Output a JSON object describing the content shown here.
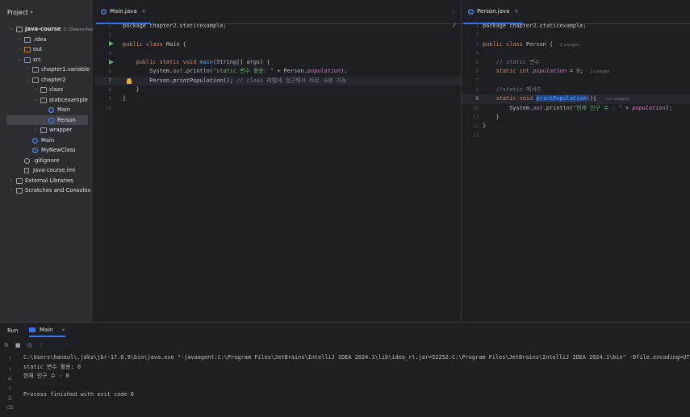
{
  "project": {
    "title": "Project",
    "tree": [
      {
        "label": "Java-course",
        "path": "C:\\Users\\hane",
        "icon": "folder",
        "depth": 0,
        "expanded": true,
        "bold": true
      },
      {
        "label": ".idea",
        "icon": "folder",
        "depth": 1,
        "expanded": false
      },
      {
        "label": "out",
        "icon": "folder-orange",
        "depth": 1,
        "expanded": false
      },
      {
        "label": "src",
        "icon": "folder-blue",
        "depth": 1,
        "expanded": true
      },
      {
        "label": "chapter1.variable",
        "icon": "folder",
        "depth": 2,
        "expanded": false
      },
      {
        "label": "chapter2",
        "icon": "folder",
        "depth": 2,
        "expanded": true
      },
      {
        "label": "clazz",
        "icon": "folder",
        "depth": 3,
        "expanded": false
      },
      {
        "label": "staticexample",
        "icon": "folder",
        "depth": 3,
        "expanded": true
      },
      {
        "label": "Main",
        "icon": "class",
        "depth": 4
      },
      {
        "label": "Person",
        "icon": "class",
        "depth": 4,
        "selected": true
      },
      {
        "label": "wrapper",
        "icon": "folder",
        "depth": 3,
        "expanded": false
      },
      {
        "label": "Main",
        "icon": "class",
        "depth": 2
      },
      {
        "label": "MyNewClass",
        "icon": "class",
        "depth": 2
      },
      {
        "label": ".gitignore",
        "icon": "ignore",
        "depth": 1
      },
      {
        "label": "Java-course.iml",
        "icon": "file",
        "depth": 1
      },
      {
        "label": "External Libraries",
        "icon": "lib",
        "depth": 0,
        "expanded": false
      },
      {
        "label": "Scratches and Consoles",
        "icon": "scratch",
        "depth": 0,
        "expanded": false
      }
    ]
  },
  "editor_left": {
    "tab": "Main.java",
    "line_numbers": [
      "1",
      "2",
      "3",
      "4",
      "5",
      "6",
      "7",
      "8",
      "9",
      "10"
    ],
    "lines": [
      [
        {
          "t": "package chapter2.staticexample;",
          "c": ""
        }
      ],
      [],
      [
        {
          "t": "public class ",
          "c": "kw"
        },
        {
          "t": "Main {",
          "c": ""
        }
      ],
      [],
      [
        {
          "t": "    public static void ",
          "c": "kw"
        },
        {
          "t": "main",
          "c": "fn"
        },
        {
          "t": "(String[] args) {",
          "c": ""
        }
      ],
      [
        {
          "t": "        System.",
          "c": ""
        },
        {
          "t": "out",
          "c": "st"
        },
        {
          "t": ".println(",
          "c": ""
        },
        {
          "t": "\"static 변수 활용: \"",
          "c": "str"
        },
        {
          "t": " + Person.",
          "c": ""
        },
        {
          "t": "population",
          "c": "st"
        },
        {
          "t": ");",
          "c": ""
        }
      ],
      [
        {
          "t": "        Person.",
          "c": ""
        },
        {
          "t": "printPopulation",
          "c": "it"
        },
        {
          "t": "(); ",
          "c": ""
        },
        {
          "t": "// class 레벨에 접근해서 바로 사용 가능",
          "c": "cm"
        }
      ],
      [
        {
          "t": "    }",
          "c": ""
        }
      ],
      [
        {
          "t": "}",
          "c": ""
        }
      ],
      []
    ]
  },
  "editor_right": {
    "tab": "Person.java",
    "line_numbers": [
      "1",
      "2",
      "3",
      "4",
      "5",
      "6",
      "7",
      "8",
      "9",
      "10",
      "11",
      "12",
      "13"
    ],
    "lines": [
      [
        {
          "t": "package chapter2.staticexample;",
          "c": ""
        }
      ],
      [],
      [
        {
          "t": "public class ",
          "c": "kw"
        },
        {
          "t": "Person {  ",
          "c": ""
        },
        {
          "t": "2 usages",
          "c": "hint"
        }
      ],
      [],
      [
        {
          "t": "    // static 변수",
          "c": "cm"
        }
      ],
      [
        {
          "t": "    static int ",
          "c": "kw"
        },
        {
          "t": "population",
          "c": "st"
        },
        {
          "t": " = ",
          "c": ""
        },
        {
          "t": "0",
          "c": "fn"
        },
        {
          "t": ";  ",
          "c": ""
        },
        {
          "t": "2 usages",
          "c": "hint"
        }
      ],
      [],
      [
        {
          "t": "    //static 메서드",
          "c": "cm"
        }
      ],
      [
        {
          "t": "    static void ",
          "c": "kw"
        },
        {
          "t": "printPopulation",
          "c": "fn selword"
        },
        {
          "t": "(){   ",
          "c": ""
        },
        {
          "t": "no usages",
          "c": "hint"
        }
      ],
      [
        {
          "t": "        System.",
          "c": ""
        },
        {
          "t": "out",
          "c": "st"
        },
        {
          "t": ".println(",
          "c": ""
        },
        {
          "t": "\"현재 인구 수 : \"",
          "c": "str"
        },
        {
          "t": " + ",
          "c": ""
        },
        {
          "t": "population",
          "c": "st"
        },
        {
          "t": ");",
          "c": ""
        }
      ],
      [
        {
          "t": "    }",
          "c": ""
        }
      ],
      [
        {
          "t": "}",
          "c": ""
        }
      ],
      []
    ]
  },
  "run": {
    "title": "Run",
    "tab": "Main",
    "console": [
      "C:\\Users\\haneul\\.jdks\\jbr-17.0.9\\bin\\java.exe \"-javaagent:C:\\Program Files\\JetBrains\\IntelliJ IDEA 2024.1\\lib\\idea_rt.jar=52252:C:\\Program Files\\JetBrains\\IntelliJ IDEA 2024.1\\bin\" -Dfile.encoding=UTF-8",
      "static 변수 활용: 0",
      "현재 인구 수 : 0",
      "",
      "Process finished with exit code 0"
    ]
  },
  "colors": {
    "accent": "#3574f0",
    "keyword": "#cf8e6d",
    "string": "#6aab73",
    "function": "#56a8f5",
    "static_field": "#c77dbb"
  }
}
